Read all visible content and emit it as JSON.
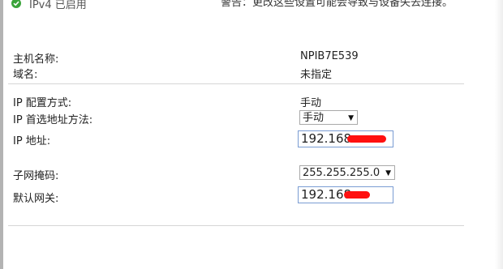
{
  "status": {
    "ipv4_enabled": "IPv4 已启用",
    "warning": "警告：更改这些设置可能会导致与设备失去连接。"
  },
  "info": {
    "hostname_label": "主机名称:",
    "hostname_value": "NPIB7E539",
    "domain_label": "域名:",
    "domain_value": "未指定"
  },
  "ip_config": {
    "config_method_label": "IP 配置方式:",
    "config_method_value": "手动",
    "preferred_method_label": "IP 首选地址方法:",
    "preferred_method_selected": "手动",
    "ip_address_label": "IP 地址:",
    "ip_address_value": "192.168.",
    "subnet_label": "子网掩码:",
    "subnet_selected": "255.255.255.0",
    "gateway_label": "默认网关:",
    "gateway_value": "192.168."
  },
  "colors": {
    "check": "#3aa43a",
    "input_border": "#7a9cd3",
    "redaction": "#ff1010",
    "divider": "#d6d6d6"
  },
  "icons": {
    "status_icon": "check-circle-icon",
    "dropdown_icon": "caret-down-icon"
  }
}
